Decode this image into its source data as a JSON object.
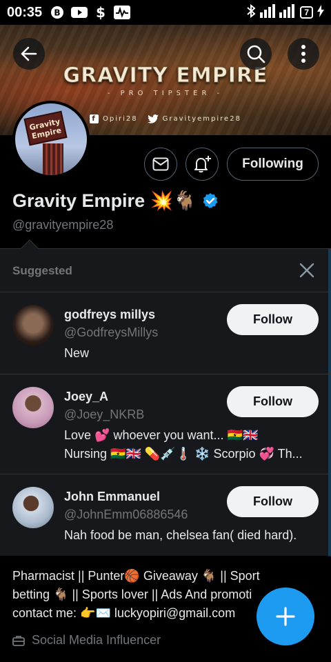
{
  "status_bar": {
    "time": "00:35",
    "battery": "7"
  },
  "banner": {
    "title": "GRAVITY EMPIRE",
    "subtitle": "- PRO TIPSTER -",
    "facebook": "Opiri28",
    "twitter": "Gravityempire28"
  },
  "avatar": {
    "sign_text": "Gravity Empire"
  },
  "profile": {
    "name": "Gravity Empire 💥🐐",
    "handle": "@gravityempire28",
    "following_label": "Following"
  },
  "suggested": {
    "header": "Suggested",
    "users": [
      {
        "name": "godfreys millys",
        "handle": "@GodfreysMillys",
        "bio": [
          "New"
        ],
        "follow_label": "Follow"
      },
      {
        "name": "Joey_A",
        "handle": "@Joey_NKRB",
        "bio": [
          "Love 💕 whoever you want... 🇬🇭🇬🇧",
          "Nursing 🇬🇭🇬🇧 💊💉🌡️ ❄️ Scorpio 💞 Th..."
        ],
        "follow_label": "Follow"
      },
      {
        "name": "John Emmanuel",
        "handle": "@JohnEmm06886546",
        "bio": [
          "Nah food be man, chelsea fan( died hard)."
        ],
        "follow_label": "Follow"
      }
    ]
  },
  "bio": {
    "lines": [
      "Pharmacist || Punter🏀 Giveaway 🐐 || Sport",
      "betting 🐐 || Sports lover || Ads And promoti",
      "contact me: 👉✉️ luckyopiri@gmail.com"
    ],
    "category": "Social Media Influencer"
  },
  "colors": {
    "accent": "#1d9bf0",
    "background": "#000000",
    "panel": "#16181c",
    "muted": "#71767b"
  }
}
